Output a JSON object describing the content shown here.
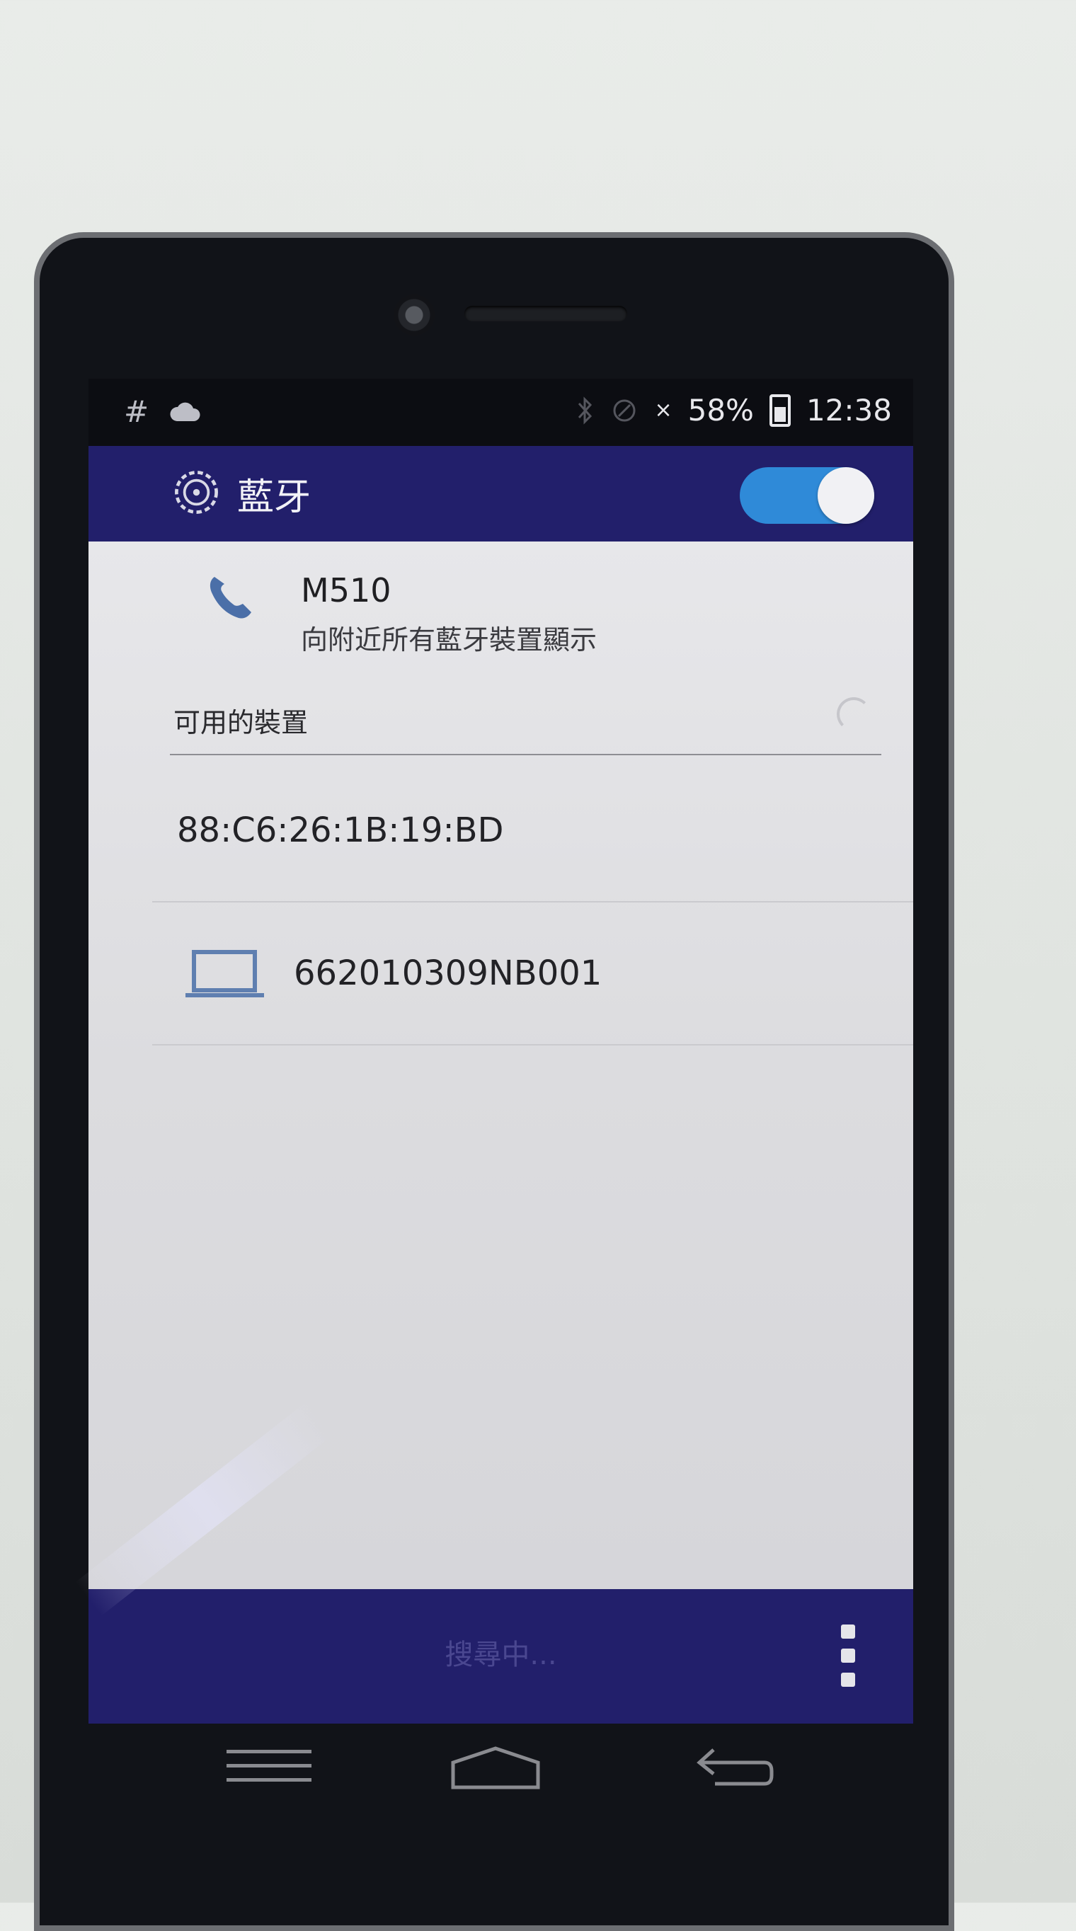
{
  "status_bar": {
    "left_icons": [
      "#",
      "cloud-icon"
    ],
    "battery": "58%",
    "time": "12:38"
  },
  "action_bar": {
    "title": "藍牙",
    "toggle_state": "on"
  },
  "this_device": {
    "name": "M510",
    "subtitle": "向附近所有藍牙裝置顯示"
  },
  "available_devices": {
    "header": "可用的裝置",
    "items": [
      {
        "label": "88:C6:26:1B:19:BD",
        "icon": ""
      },
      {
        "label": "662010309NB001",
        "icon": "laptop-icon"
      }
    ]
  },
  "bottom_bar": {
    "label": "搜尋中..."
  },
  "colors": {
    "accent": "#221f6b",
    "toggle": "#2f8ad8",
    "background": "#e2e2e5"
  }
}
